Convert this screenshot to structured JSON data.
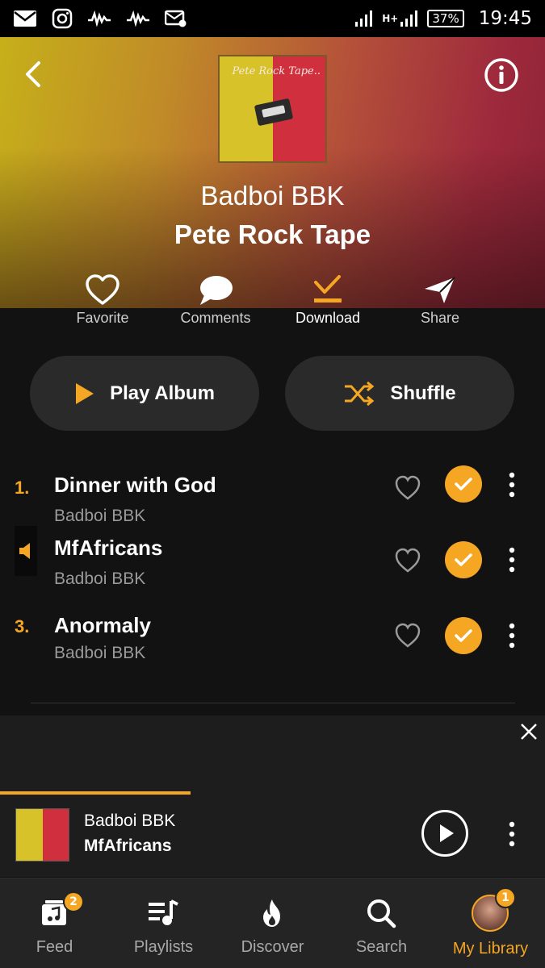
{
  "status_bar": {
    "battery": "37%",
    "network": "H+",
    "time": "19:45"
  },
  "header": {
    "artist": "Badboi BBK",
    "album": "Pete Rock Tape",
    "cover_script": "Pete Rock Tape..",
    "gradient": [
      "#c6b01a",
      "#9e2a3c"
    ]
  },
  "actions": [
    {
      "label": "Favorite",
      "icon": "heart-outline-icon"
    },
    {
      "label": "Comments",
      "icon": "speech-bubble-icon"
    },
    {
      "label": "Download",
      "icon": "download-check-icon"
    },
    {
      "label": "Share",
      "icon": "paper-plane-icon"
    }
  ],
  "buttons": {
    "play_album": "Play Album",
    "shuffle": "Shuffle"
  },
  "tracks": [
    {
      "number": "1.",
      "title": "Dinner with God",
      "artist": "Badboi BBK",
      "playing": false,
      "downloaded": true
    },
    {
      "number": "",
      "title": "MfAfricans",
      "artist": "Badboi BBK",
      "playing": true,
      "downloaded": true
    },
    {
      "number": "3.",
      "title": "Anormaly",
      "artist": "Badboi BBK",
      "playing": false,
      "downloaded": true
    }
  ],
  "mini_player": {
    "artist": "Badboi BBK",
    "title": "MfAfricans",
    "progress": 0.35
  },
  "nav": [
    {
      "label": "Feed",
      "badge": "2",
      "icon": "feed-icon"
    },
    {
      "label": "Playlists",
      "icon": "playlists-icon"
    },
    {
      "label": "Discover",
      "icon": "flame-icon"
    },
    {
      "label": "Search",
      "icon": "search-icon"
    },
    {
      "label": "My Library",
      "badge": "1",
      "icon": "avatar-icon",
      "active": true
    }
  ],
  "colors": {
    "accent": "#f5a623",
    "background": "#121212",
    "pill": "#2a2a2a"
  }
}
